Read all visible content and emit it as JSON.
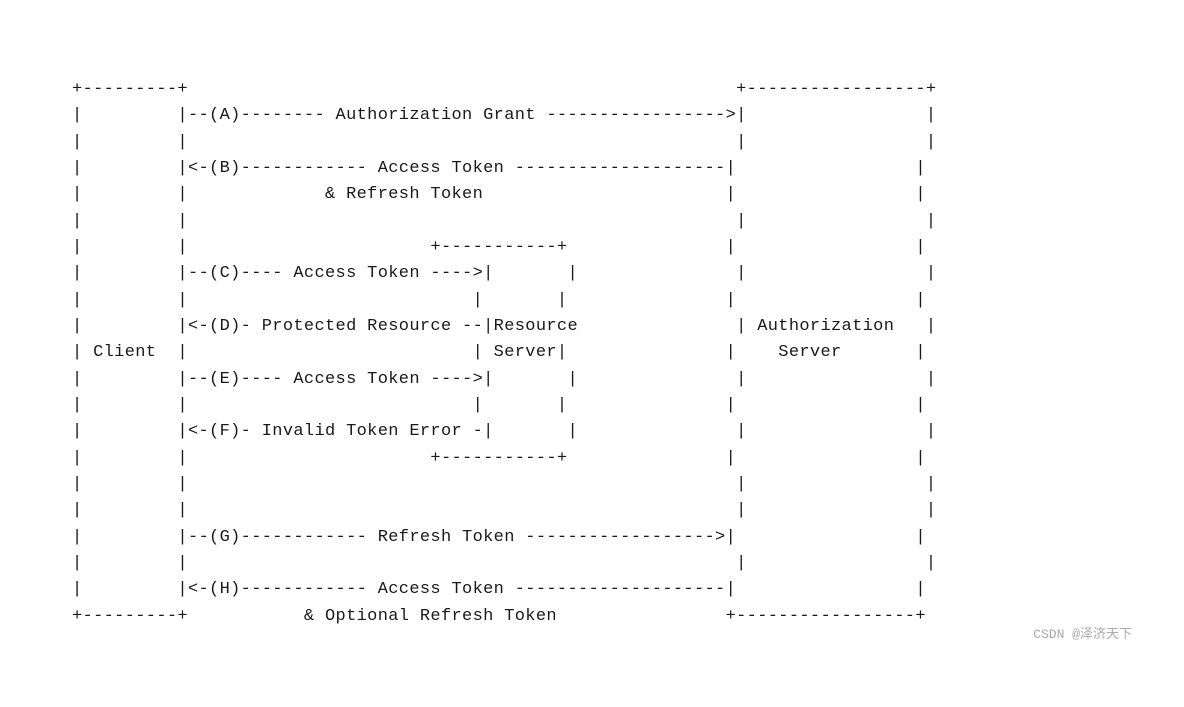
{
  "diagram": {
    "lines": [
      "+---------+                                             +-----------------+",
      "|         |--(A)-------- Authorization Grant --------->|                 |",
      "|         |                                            |                 |",
      "|         |<-(B)------------ Access Token ------------|                 |",
      "|         |             & Refresh Token               |                 |",
      "|         |                                            |                 |",
      "|         |                        +-----------+       |                 |",
      "|         |--(C)---- Access Token ---->|       |       |                 |",
      "|         |                           |       |       |                 |",
      "|         |<-(D)- Protected Resource --|Resource       | Authorization   |",
      "|  Client |                           | Server|       |    Server       |",
      "|         |--(E)---- Access Token ---->|       |       |                 |",
      "|         |                           |       |       |                 |",
      "|         |<-(F)- Invalid Token Error -|       |       |                 |",
      "|         |                        +-----------+       |                 |",
      "|         |                                            |                 |",
      "|         |                                            |                 |",
      "|         |--(G)------------ Refresh Token ----------->|                 |",
      "|         |                                            |                 |",
      "|         |<-(H)------------ Access Token -------------|                 |",
      "+---------+             & Optional Refresh Token       +-----------------+"
    ],
    "watermark": "CSDN @泽济天下"
  }
}
